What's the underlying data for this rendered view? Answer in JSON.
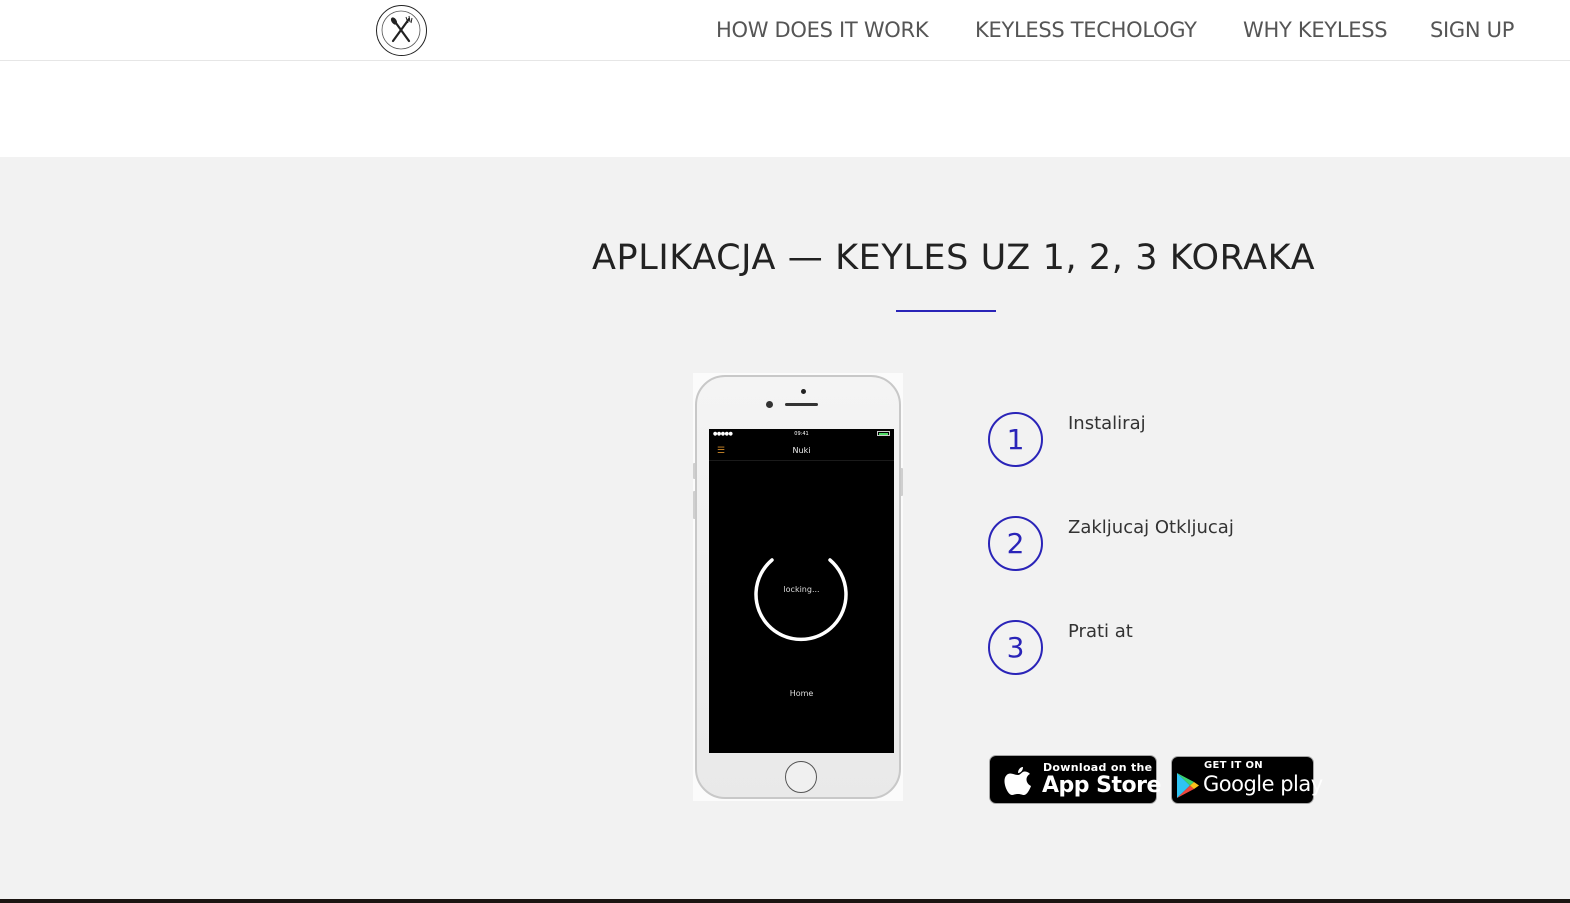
{
  "nav": {
    "logo_alt": "logo",
    "links": [
      "HOW DOES IT WORK",
      "KEYLESS TECHOLOGY",
      "WHY KEYLESS",
      "SIGN UP"
    ]
  },
  "section": {
    "title": "APLIKACJA — KEYLES UZ 1, 2, 3 KORAKA",
    "steps": [
      {
        "number": "1",
        "label": "Instaliraj"
      },
      {
        "number": "2",
        "label": "Zakljucaj Otkljucaj"
      },
      {
        "number": "3",
        "label": "Prati at"
      }
    ]
  },
  "phone": {
    "status_time": "09:41",
    "status_signal": "●●●●●",
    "app_title": "Nuki",
    "lock_status": "locking...",
    "lock_location": "Home"
  },
  "badges": {
    "apple": {
      "small": "Download on the",
      "big": "App Store"
    },
    "google": {
      "small": "GET IT ON",
      "big": "Google play"
    }
  },
  "colors": {
    "accent": "#2a24b8",
    "section_bg": "#f2f2f2",
    "nav_text": "#555555",
    "title_text": "#222222"
  }
}
